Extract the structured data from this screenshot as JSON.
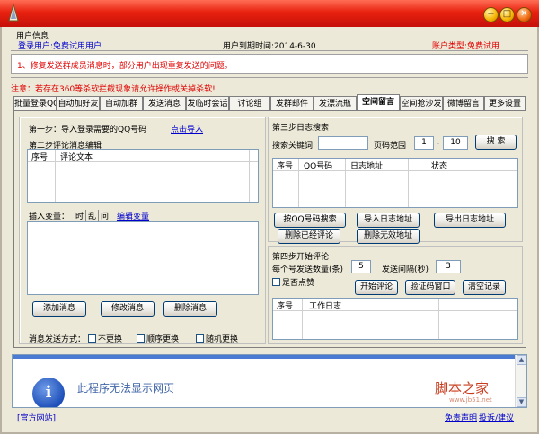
{
  "window": {
    "min": "−",
    "max": "□",
    "close": "✕"
  },
  "user_info": {
    "title": "用户信息",
    "login_user": "登录用户:免费试用用户",
    "expiry": "用户到期时间:2014-6-30",
    "account_type": "账户类型:免费试用"
  },
  "notice": {
    "line1": "1、修复发送群成员消息时，部分用户出现重复发送的问题。",
    "line2": "注意：若存在360等杀软拦截现象请允许操作或关掉杀软!"
  },
  "tabs": [
    "批量登录QQ",
    "自动加好友",
    "自动加群",
    "发送消息",
    "发临时会话",
    "讨论组",
    "发群邮件",
    "发漂流瓶",
    "空间留言",
    "空间抢沙发",
    "微博留言",
    "更多设置"
  ],
  "left": {
    "step1": "第一步：导入登录需要的QQ号码",
    "step1_link": "点击导入",
    "step2": "第二步评论消息编辑",
    "cols": [
      "序号",
      "评论文本"
    ],
    "insert_var": "插入变量：",
    "var_time": "时",
    "var_random": "乱",
    "var_question": "问",
    "edit_var": "编辑变量",
    "btn_add": "添加消息",
    "btn_modify": "修改消息",
    "btn_delete": "删除消息",
    "send_mode": "消息发送方式：",
    "opt_none": "不更换",
    "opt_seq": "顺序更换",
    "opt_random": "随机更换"
  },
  "right": {
    "step3": "第三步日志搜索",
    "search_kw": "搜索关键词",
    "page_range": "页码范围",
    "page_from": "1",
    "page_to": "10",
    "btn_search": "搜 索",
    "cols": [
      "序号",
      "QQ号码",
      "日志地址",
      "状态"
    ],
    "btn_by_qq": "按QQ号码搜索",
    "btn_import": "导入日志地址",
    "btn_export": "导出日志地址",
    "btn_del_commented": "删除已经评论",
    "btn_del_invalid": "删除无效地址",
    "step4": "第四步开始评论",
    "per_count": "每个号发送数量(条)",
    "per_count_val": "5",
    "interval": "发送间隔(秒)",
    "interval_val": "3",
    "like": "是否点赞",
    "btn_start": "开始评论",
    "btn_captcha": "验证码窗口",
    "btn_clear": "清空记录",
    "log_cols": [
      "序号",
      "工作日志"
    ]
  },
  "browser": {
    "message": "此程序无法显示网页",
    "watermark": "脚本之家",
    "watermark_url": "www.jb51.net"
  },
  "status": {
    "site": "[官方网站]",
    "disclaimer": "免责声明",
    "feedback": "投诉/建议"
  }
}
